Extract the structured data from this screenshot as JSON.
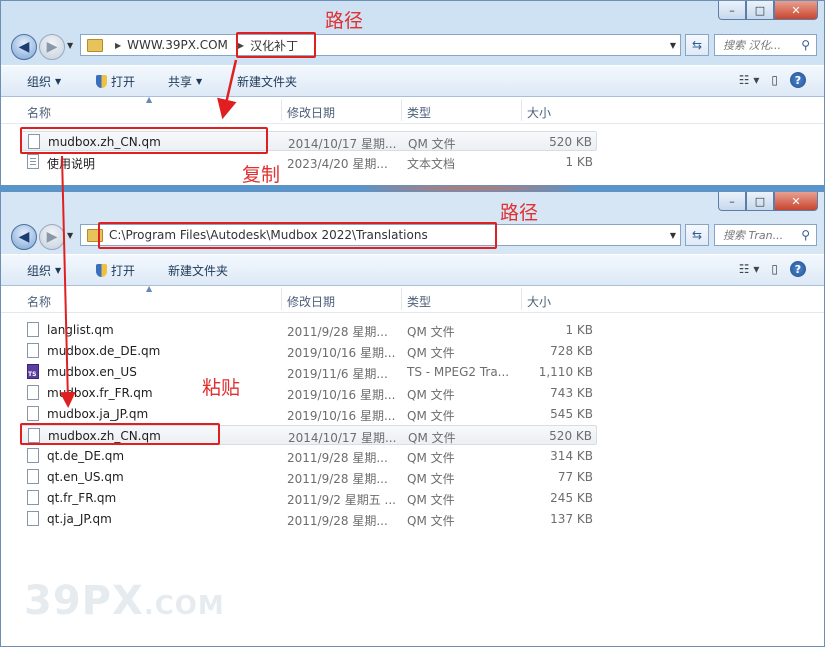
{
  "window_top": {
    "caption": {
      "minimize": "–",
      "maximize": "□",
      "close": "✕"
    },
    "nav": {
      "back": "◀",
      "forward": "▶"
    },
    "address": {
      "segments": [
        "WWW.39PX.COM",
        "汉化补丁"
      ]
    },
    "search_placeholder": "搜索 汉化...",
    "toolbar": {
      "organize": "组织",
      "open": "打开",
      "share": "共享",
      "new_folder": "新建文件夹"
    },
    "columns": {
      "name": "名称",
      "date": "修改日期",
      "type": "类型",
      "size": "大小"
    },
    "files": [
      {
        "name": "mudbox.zh_CN.qm",
        "date": "2014/10/17 星期...",
        "type": "QM 文件",
        "size": "520 KB",
        "icon": "file",
        "selected": true
      },
      {
        "name": "使用说明",
        "date": "2023/4/20 星期...",
        "type": "文本文档",
        "size": "1 KB",
        "icon": "txt"
      }
    ]
  },
  "window_bottom": {
    "caption": {
      "minimize": "–",
      "maximize": "□",
      "close": "✕"
    },
    "nav": {
      "back": "◀",
      "forward": "▶"
    },
    "address": {
      "path": "C:\\Program Files\\Autodesk\\Mudbox 2022\\Translations"
    },
    "search_placeholder": "搜索 Tran...",
    "toolbar": {
      "organize": "组织",
      "open": "打开",
      "new_folder": "新建文件夹"
    },
    "columns": {
      "name": "名称",
      "date": "修改日期",
      "type": "类型",
      "size": "大小"
    },
    "files": [
      {
        "name": "langlist.qm",
        "date": "2011/9/28 星期...",
        "type": "QM 文件",
        "size": "1 KB",
        "icon": "file"
      },
      {
        "name": "mudbox.de_DE.qm",
        "date": "2019/10/16 星期...",
        "type": "QM 文件",
        "size": "728 KB",
        "icon": "file"
      },
      {
        "name": "mudbox.en_US",
        "date": "2019/11/6 星期...",
        "type": "TS - MPEG2 Tra...",
        "size": "1,110 KB",
        "icon": "ts"
      },
      {
        "name": "mudbox.fr_FR.qm",
        "date": "2019/10/16 星期...",
        "type": "QM 文件",
        "size": "743 KB",
        "icon": "file"
      },
      {
        "name": "mudbox.ja_JP.qm",
        "date": "2019/10/16 星期...",
        "type": "QM 文件",
        "size": "545 KB",
        "icon": "file"
      },
      {
        "name": "mudbox.zh_CN.qm",
        "date": "2014/10/17 星期...",
        "type": "QM 文件",
        "size": "520 KB",
        "icon": "file",
        "selected": true
      },
      {
        "name": "qt.de_DE.qm",
        "date": "2011/9/28 星期...",
        "type": "QM 文件",
        "size": "314 KB",
        "icon": "file"
      },
      {
        "name": "qt.en_US.qm",
        "date": "2011/9/28 星期...",
        "type": "QM 文件",
        "size": "77 KB",
        "icon": "file"
      },
      {
        "name": "qt.fr_FR.qm",
        "date": "2011/9/2 星期五 ...",
        "type": "QM 文件",
        "size": "245 KB",
        "icon": "file"
      },
      {
        "name": "qt.ja_JP.qm",
        "date": "2011/9/28 星期...",
        "type": "QM 文件",
        "size": "137 KB",
        "icon": "file"
      }
    ]
  },
  "annotations": {
    "path_top": "路径",
    "copy": "复制",
    "path_bottom": "路径",
    "paste": "粘贴",
    "color": "#e02020"
  },
  "watermark": {
    "main": "39PX",
    "suffix": ".COM"
  }
}
